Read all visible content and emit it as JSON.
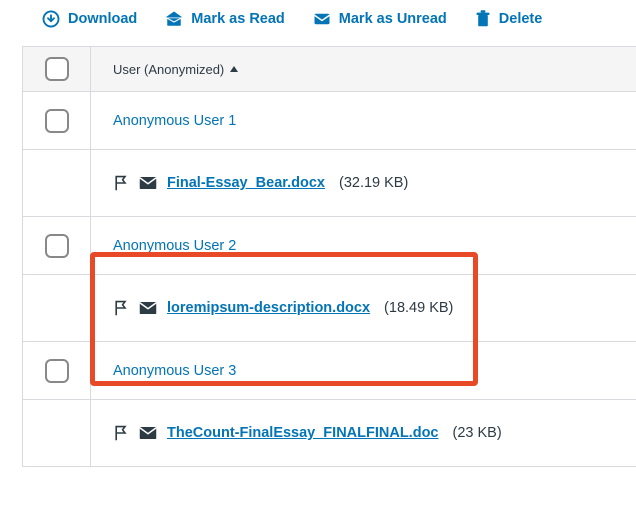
{
  "toolbar": {
    "download": "Download",
    "mark_read": "Mark as Read",
    "mark_unread": "Mark as Unread",
    "delete": "Delete"
  },
  "header": {
    "user_col": "User (Anonymized)"
  },
  "rows": [
    {
      "user": "Anonymous User 1",
      "file": "Final-Essay_Bear.docx",
      "size": "(32.19 KB)"
    },
    {
      "user": "Anonymous User 2",
      "file": "loremipsum-description.docx",
      "size": "(18.49 KB)"
    },
    {
      "user": "Anonymous User 3",
      "file": "TheCount-FinalEssay_FINALFINAL.doc",
      "size": "(23 KB)"
    }
  ]
}
